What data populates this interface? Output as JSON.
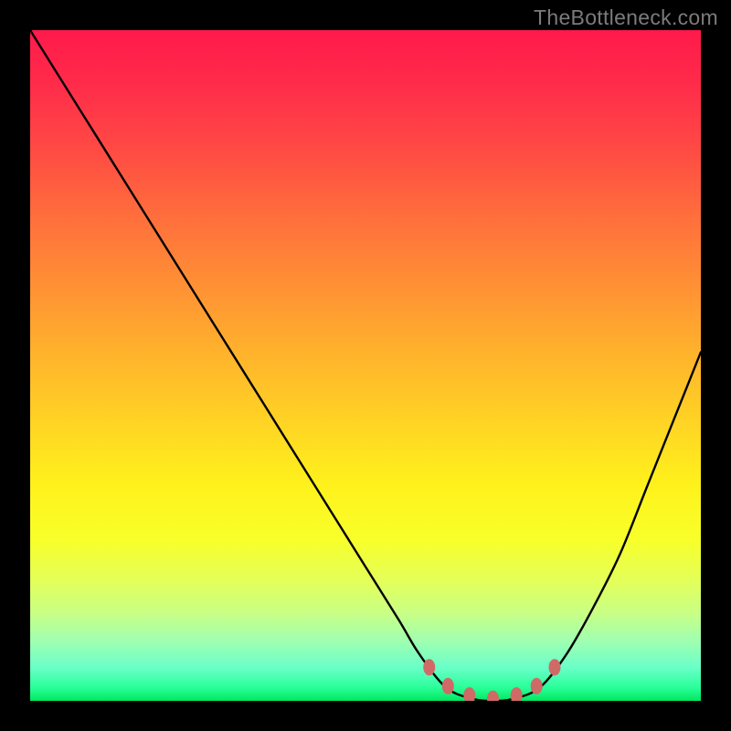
{
  "watermark": "TheBottleneck.com",
  "chart_data": {
    "type": "line",
    "title": "",
    "xlabel": "",
    "ylabel": "",
    "xlim": [
      0,
      100
    ],
    "ylim": [
      0,
      100
    ],
    "grid": false,
    "series": [
      {
        "name": "bottleneck-curve",
        "color": "#000000",
        "x": [
          0,
          5,
          10,
          15,
          20,
          25,
          30,
          35,
          40,
          45,
          50,
          55,
          58,
          62,
          66,
          69,
          72,
          76,
          80,
          84,
          88,
          92,
          96,
          100
        ],
        "values": [
          100,
          92,
          84,
          76,
          68,
          60,
          52,
          44,
          36,
          28,
          20,
          12,
          7,
          2,
          0.3,
          0,
          0.3,
          2,
          7,
          14,
          22,
          32,
          42,
          52
        ]
      }
    ],
    "markers": {
      "name": "optimal-range",
      "color": "#cf6a66",
      "points": [
        {
          "x": 59.5,
          "y": 5.0
        },
        {
          "x": 62.3,
          "y": 2.2
        },
        {
          "x": 65.5,
          "y": 0.8
        },
        {
          "x": 69.0,
          "y": 0.3
        },
        {
          "x": 72.5,
          "y": 0.8
        },
        {
          "x": 75.5,
          "y": 2.2
        },
        {
          "x": 78.2,
          "y": 5.0
        }
      ]
    },
    "background": {
      "type": "vertical-gradient",
      "stops": [
        {
          "pos": 0.0,
          "hex": "#ff1a4b"
        },
        {
          "pos": 0.5,
          "hex": "#ffc424"
        },
        {
          "pos": 0.8,
          "hex": "#f8ff2a"
        },
        {
          "pos": 1.0,
          "hex": "#00e85f"
        }
      ]
    }
  }
}
